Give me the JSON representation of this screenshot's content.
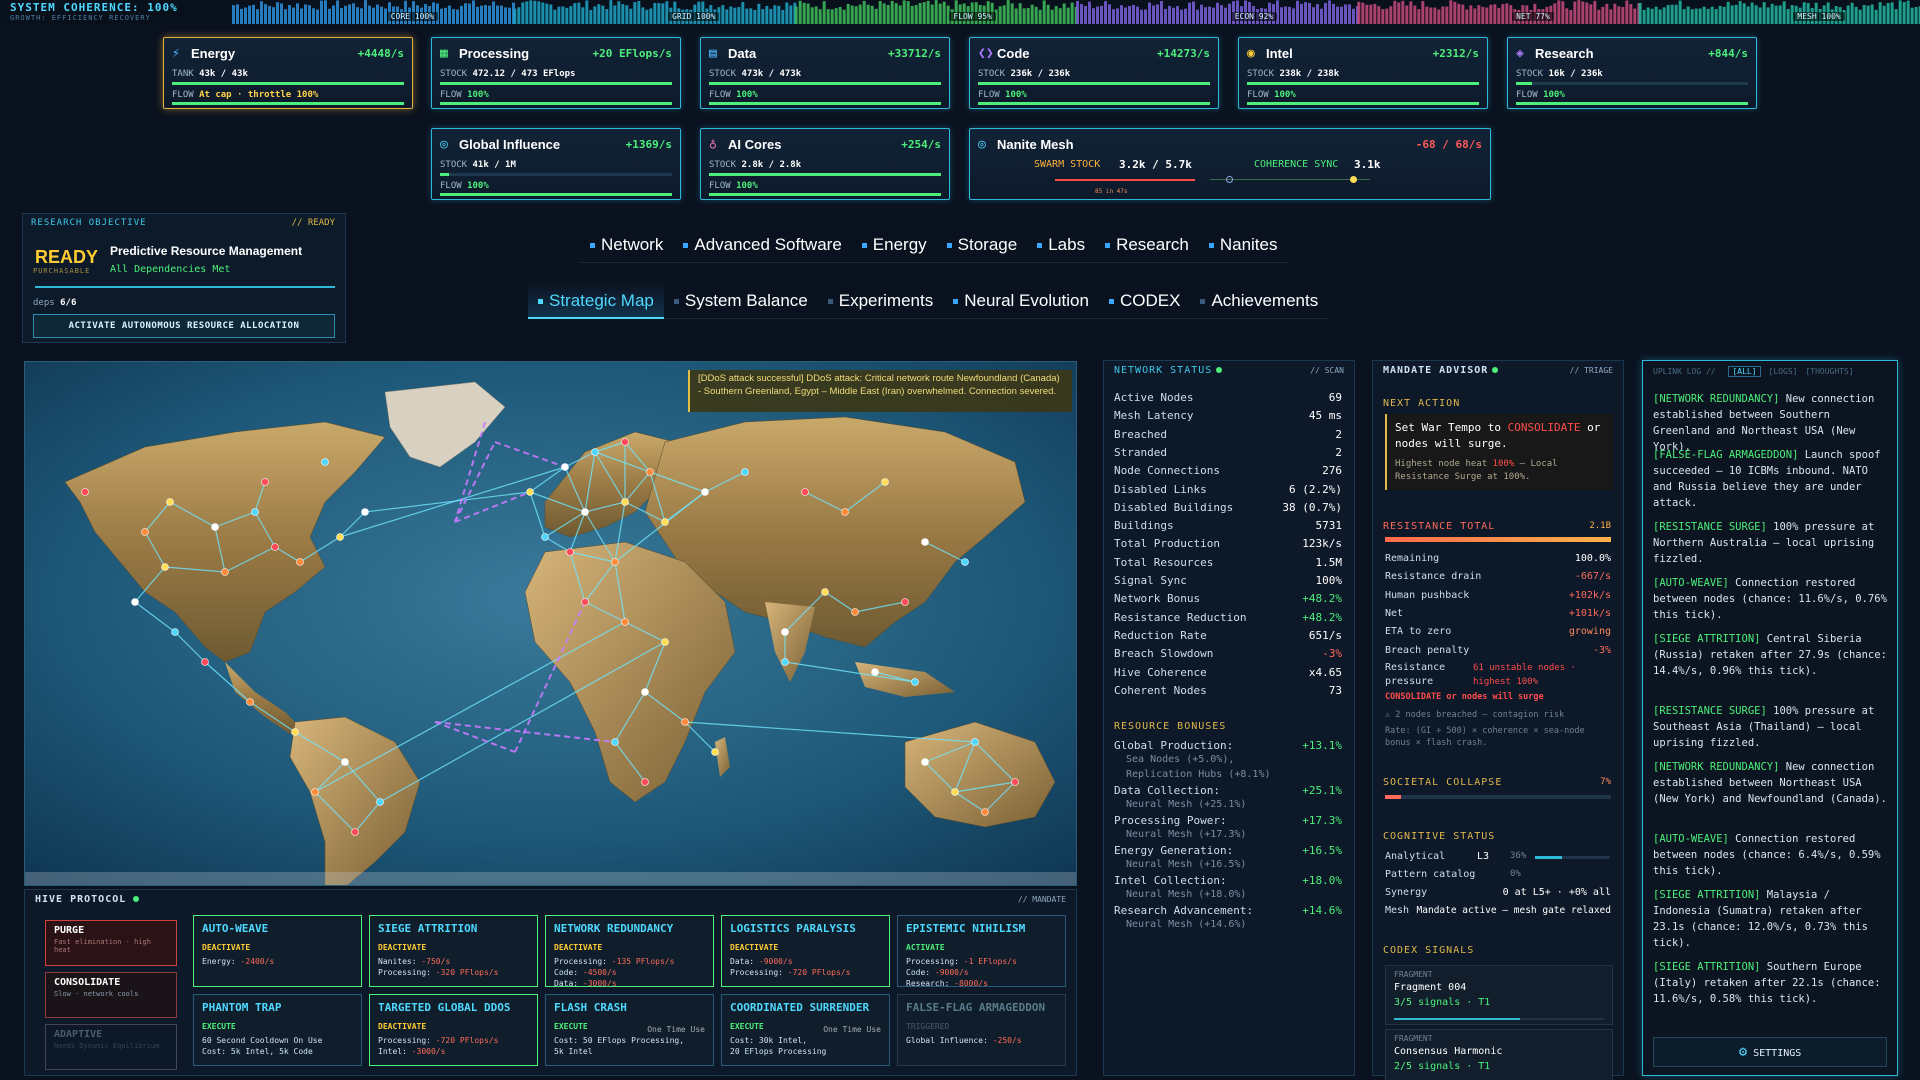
{
  "topbar": {
    "title": "SYSTEM COHERENCE: 100%",
    "subtitle": "GROWTH: EFFICIENCY RECOVERY",
    "segments": [
      {
        "label": "CORE 100%",
        "color": "#2c8fd8"
      },
      {
        "label": "GRID 100%",
        "color": "#1fa6c8"
      },
      {
        "label": "FLOW 95%",
        "color": "#3fbf5a"
      },
      {
        "label": "ECON 92%",
        "color": "#7a5fd8"
      },
      {
        "label": "NET 77%",
        "color": "#c84a7a"
      },
      {
        "label": "MESH 100%",
        "color": "#22b8a0"
      }
    ]
  },
  "resources": [
    {
      "icon": "⚡",
      "icon_name": "lightning-icon",
      "icon_color": "#4fb8ff",
      "name": "Energy",
      "rate": "+4448/s",
      "stock_label": "TANK",
      "stock": "43k / 43k",
      "flow": "At cap · throttle 100%",
      "fill": 1.0
    },
    {
      "icon": "▦",
      "icon_name": "processor-icon",
      "icon_color": "#4cef7a",
      "name": "Processing",
      "rate": "+20 EFlops/s",
      "stock_label": "STOCK",
      "stock": "472.12 / 473 EFlops",
      "flow": "100%",
      "fill": 0.998
    },
    {
      "icon": "▤",
      "icon_name": "database-icon",
      "icon_color": "#4fb8ff",
      "name": "Data",
      "rate": "+33712/s",
      "stock_label": "STOCK",
      "stock": "473k / 473k",
      "flow": "100%",
      "fill": 1.0
    },
    {
      "icon": "❮❯",
      "icon_name": "code-icon",
      "icon_color": "#b07aff",
      "name": "Code",
      "rate": "+14273/s",
      "stock_label": "STOCK",
      "stock": "236k / 236k",
      "flow": "100%",
      "fill": 1.0
    },
    {
      "icon": "◉",
      "icon_name": "intel-icon",
      "icon_color": "#ffcc33",
      "name": "Intel",
      "rate": "+2312/s",
      "stock_label": "STOCK",
      "stock": "238k / 238k",
      "flow": "100%",
      "fill": 1.0
    },
    {
      "icon": "◈",
      "icon_name": "layers-icon",
      "icon_color": "#b07aff",
      "name": "Research",
      "rate": "+844/s",
      "stock_label": "STOCK",
      "stock": "16k / 236k",
      "flow": "100%",
      "fill": 0.07
    },
    {
      "icon": "◎",
      "icon_name": "shield-icon",
      "icon_color": "#4fd8ff",
      "name": "Global Influence",
      "rate": "+1369/s",
      "stock_label": "STOCK",
      "stock": "41k / 1M",
      "flow": "100%",
      "fill": 0.04
    },
    {
      "icon": "♁",
      "icon_name": "brain-icon",
      "icon_color": "#ff7ac8",
      "name": "AI Cores",
      "rate": "+254/s",
      "stock_label": "STOCK",
      "stock": "2.8k / 2.8k",
      "flow": "100%",
      "fill": 1.0
    }
  ],
  "nanite": {
    "icon": "◎",
    "icon_name": "nanite-icon",
    "name": "Nanite Mesh",
    "rate": "-68 / 68/s",
    "swarm_label": "SWARM STOCK",
    "swarm_value": "3.2k / 5.7k",
    "sync_label": "COHERENCE SYNC",
    "sync_value": "3.1k",
    "sub": "85 in 47s"
  },
  "research": {
    "header": "RESEARCH OBJECTIVE",
    "status": "// READY",
    "ready": "READY",
    "purchasable": "PURCHASABLE",
    "name": "Predictive Resource Management",
    "deps_met": "All Dependencies Met",
    "deps_label": "deps",
    "deps_value": "6/6",
    "button": "ACTIVATE AUTONOMOUS RESOURCE ALLOCATION"
  },
  "tabs_row1": [
    "Network",
    "Advanced Software",
    "Energy",
    "Storage",
    "Labs",
    "Research",
    "Nanites"
  ],
  "tabs_row2": [
    "Strategic Map",
    "System Balance",
    "Experiments",
    "Neural Evolution",
    "CODEX",
    "Achievements"
  ],
  "ddos_message": "[DDoS attack successful] DDoS attack: Critical network route Newfoundland (Canada) - Southern Greenland, Egypt – Middle East (Iran) overwhelmed. Connection severed.",
  "hive": {
    "title": "HIVE PROTOCOL",
    "tag": "// MANDATE",
    "modes": [
      {
        "title": "PURGE",
        "sub": "Fast elimination · high heat"
      },
      {
        "title": "CONSOLIDATE",
        "sub": "Slow · network cools"
      },
      {
        "title": "ADAPTIVE",
        "sub": "Needs Dynamic Equilibrium"
      }
    ],
    "protocols": [
      {
        "title": "AUTO-WEAVE",
        "state": "DEACTIVATE",
        "cooldown": "",
        "lines": [
          [
            "Energy: ",
            "-2400/s"
          ]
        ]
      },
      {
        "title": "SIEGE ATTRITION",
        "state": "DEACTIVATE",
        "cooldown": "",
        "lines": [
          [
            "Nanites: ",
            "-750/s"
          ],
          [
            "Processing: ",
            "-320 PFlops/s"
          ]
        ]
      },
      {
        "title": "NETWORK REDUNDANCY",
        "state": "DEACTIVATE",
        "cooldown": "",
        "lines": [
          [
            "Processing: ",
            "-135 PFlops/s"
          ],
          [
            "Code: ",
            "-4500/s"
          ],
          [
            " Data: ",
            "-3000/s"
          ]
        ]
      },
      {
        "title": "LOGISTICS PARALYSIS",
        "state": "DEACTIVATE",
        "cooldown": "",
        "lines": [
          [
            "Data: ",
            "-9000/s"
          ],
          [
            "Processing: ",
            "-720 PFlops/s"
          ]
        ]
      },
      {
        "title": "EPISTEMIC NIHILISM",
        "state": "ACTIVATE",
        "cooldown": "",
        "lines": [
          [
            "Processing: ",
            "-1 EFlops/s"
          ],
          [
            "Code: ",
            "-9000/s"
          ],
          [
            "Research: ",
            "-8000/s"
          ]
        ]
      },
      {
        "title": "PHANTOM TRAP",
        "state": "EXECUTE",
        "cooldown": "",
        "lines": [
          [
            "60 Second Cooldown On Use",
            ""
          ],
          [
            "Cost:  5k Intel, 5k Code",
            ""
          ]
        ]
      },
      {
        "title": "TARGETED GLOBAL DDOS",
        "state": "DEACTIVATE",
        "cooldown": "",
        "lines": [
          [
            "Processing: ",
            "-720 PFlops/s"
          ],
          [
            "Intel: ",
            "-3000/s"
          ]
        ]
      },
      {
        "title": "FLASH CRASH",
        "state": "EXECUTE",
        "cooldown": "One Time Use",
        "lines": [
          [
            "Cost:  50 EFlops Processing,",
            ""
          ],
          [
            "5k Intel",
            ""
          ]
        ]
      },
      {
        "title": "COORDINATED SURRENDER",
        "state": "EXECUTE",
        "cooldown": "One Time Use",
        "lines": [
          [
            "Cost:  30k Intel,",
            ""
          ],
          [
            "20 EFlops Processing",
            ""
          ]
        ]
      },
      {
        "title": "FALSE-FLAG ARMAGEDDON",
        "state": "TRIGGERED",
        "cooldown": "",
        "lines": [
          [
            "Global Influence: ",
            "-250/s"
          ]
        ]
      }
    ]
  },
  "network_status": {
    "title": "NETWORK STATUS",
    "tag": "// SCAN",
    "rows": [
      [
        "Active Nodes",
        "69",
        ""
      ],
      [
        "Mesh Latency",
        "45 ms",
        ""
      ],
      [
        "Breached",
        "2",
        ""
      ],
      [
        "Stranded",
        "2",
        ""
      ],
      [
        "Node Connections",
        "276",
        ""
      ],
      [
        "Disabled Links",
        "6 (2.2%)",
        ""
      ],
      [
        "Disabled Buildings",
        "38 (0.7%)",
        ""
      ],
      [
        "Buildings",
        "5731",
        ""
      ],
      [
        "Total Production",
        "123k/s",
        ""
      ],
      [
        "Total Resources",
        "1.5M",
        ""
      ],
      [
        "Signal Sync",
        "100%",
        ""
      ],
      [
        "Network Bonus",
        "+48.2%",
        "g"
      ],
      [
        "Resistance Reduction",
        "+48.2%",
        "g"
      ],
      [
        "Reduction Rate",
        "651/s",
        ""
      ],
      [
        "Breach Slowdown",
        "-3%",
        "r"
      ],
      [
        "Hive Coherence",
        "x4.65",
        ""
      ],
      [
        "Coherent Nodes",
        "73",
        ""
      ]
    ],
    "bonus_title": "RESOURCE BONUSES",
    "bonuses": [
      {
        "name": "Global Production:",
        "value": "+13.1%",
        "subs": [
          "Sea Nodes (+5.0%),",
          "Replication Hubs (+8.1%)"
        ]
      },
      {
        "name": "Data Collection:",
        "value": "+25.1%",
        "subs": [
          "Neural Mesh (+25.1%)"
        ]
      },
      {
        "name": "Processing Power:",
        "value": "+17.3%",
        "subs": [
          "Neural Mesh (+17.3%)"
        ]
      },
      {
        "name": "Energy Generation:",
        "value": "+16.5%",
        "subs": [
          "Neural Mesh (+16.5%)"
        ]
      },
      {
        "name": "Intel Collection:",
        "value": "+18.0%",
        "subs": [
          "Neural Mesh (+18.0%)"
        ]
      },
      {
        "name": "Research Advancement:",
        "value": "+14.6%",
        "subs": [
          "Neural Mesh (+14.6%)"
        ]
      }
    ]
  },
  "mandate": {
    "title": "MANDATE ADVISOR",
    "tag": "// TRIAGE",
    "next_action": "NEXT ACTION",
    "next_pre": "Set War Tempo to ",
    "next_hl": "CONSOLIDATE",
    "next_post": " or nodes will surge.",
    "next_sub_pre": "Highest node heat ",
    "next_sub_hl": "100%",
    "next_sub_post": " — Local Resistance Surge at 100%.",
    "resistance_title": "RESISTANCE TOTAL",
    "resistance_value": "2.1B",
    "rows": [
      [
        "Remaining",
        "100.0%",
        ""
      ],
      [
        "Resistance drain",
        "-667/s",
        "r"
      ],
      [
        "Human pushback",
        "+102k/s",
        "r"
      ],
      [
        "Net",
        "+101k/s",
        "r"
      ],
      [
        "ETA to zero",
        "growing",
        "o"
      ],
      [
        "Breach penalty",
        "-3%",
        "r"
      ]
    ],
    "pressure_label": "Resistance pressure",
    "pressure_value": "61 unstable nodes · highest 100%",
    "warning": "CONSOLIDATE or nodes will surge",
    "breach_note": "⚠ 2 nodes breached — contagion risk",
    "rate_note": "Rate: (GI ÷ 500) × coherence × sea-node bonus × flash crash.",
    "collapse_title": "SOCIETAL COLLAPSE",
    "collapse_value": "7%",
    "collapse_fill": 0.07,
    "cog_title": "COGNITIVE STATUS",
    "analytical_label": "Analytical",
    "analytical_level": "L3",
    "analytical_pct": "36%",
    "analytical_fill": 0.36,
    "pattern_label": "Pattern catalog",
    "pattern_pct": "0%",
    "synergy_label": "Synergy",
    "synergy_value": "0 at L5+ · +0% all",
    "mesh_label": "Mesh",
    "mesh_value": "Mandate active — mesh gate relaxed",
    "codex_title": "CODEX SIGNALS",
    "codex": [
      {
        "head": "FRAGMENT",
        "name": "Fragment 004",
        "signals": "3/5 signals · T1",
        "fill": 0.6
      },
      {
        "head": "FRAGMENT",
        "name": "Consensus Harmonic",
        "signals": "2/5 signals · T1",
        "fill": 0.4
      }
    ]
  },
  "uplink": {
    "title": "UPLINK LOG //",
    "filters": [
      "[ALL]",
      "[LOGS]",
      "[THOUGHTS]"
    ],
    "entries": [
      {
        "tag": "[NETWORK REDUNDANCY]",
        "text": " New connection established between Southern Greenland and Northeast USA (New York)."
      },
      {
        "tag": "[FALSE-FLAG ARMAGEDDON]",
        "text": " Launch spoof succeeded — 10 ICBMs inbound. NATO and Russia believe they are under attack."
      },
      {
        "tag": "[RESISTANCE SURGE]",
        "text": " 100% pressure at Northern Australia — local uprising fizzled."
      },
      {
        "tag": "[AUTO-WEAVE]",
        "text": " Connection restored between nodes (chance: 11.6%/s, 0.76% this tick)."
      },
      {
        "tag": "[SIEGE ATTRITION]",
        "text": " Central Siberia (Russia) retaken after 27.9s (chance: 14.4%/s, 0.96% this tick)."
      },
      {
        "tag": "[RESISTANCE SURGE]",
        "text": " 100% pressure at Southeast Asia (Thailand) — local uprising fizzled."
      },
      {
        "tag": "[NETWORK REDUNDANCY]",
        "text": " New connection established between Northeast USA (New York) and Newfoundland (Canada)."
      },
      {
        "tag": "[AUTO-WEAVE]",
        "text": " Connection restored between nodes (chance: 6.4%/s, 0.59% this tick)."
      },
      {
        "tag": "[SIEGE ATTRITION]",
        "text": " Malaysia / Indonesia (Sumatra) retaken after 23.1s (chance: 12.0%/s, 0.73% this tick)."
      },
      {
        "tag": "[SIEGE ATTRITION]",
        "text": " Southern Europe (Italy) retaken after 22.1s (chance: 11.6%/s, 0.58% this tick)."
      }
    ],
    "settings": "SETTINGS"
  }
}
